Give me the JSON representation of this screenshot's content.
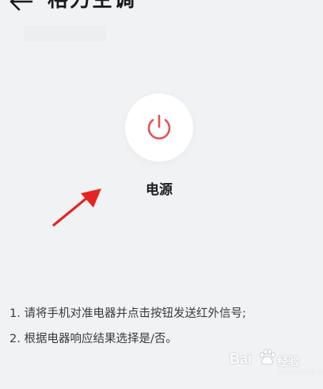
{
  "header": {
    "back_icon": "arrow-left-icon",
    "title": "格力空调"
  },
  "power": {
    "icon": "power-icon",
    "label": "电源",
    "accent_color": "#e8524f"
  },
  "annotation": {
    "icon": "red-arrow-icon",
    "color": "#e52421"
  },
  "instructions": [
    "1. 请将手机对准电器并点击按钮发送红外信号;",
    "2. 根据电器响应结果选择是/否。"
  ],
  "watermark": {
    "logo": "Bai",
    "paw_icon": "baidu-paw-icon",
    "cn_text": "经验",
    "sub_text": "jingyan.baidu.com"
  }
}
